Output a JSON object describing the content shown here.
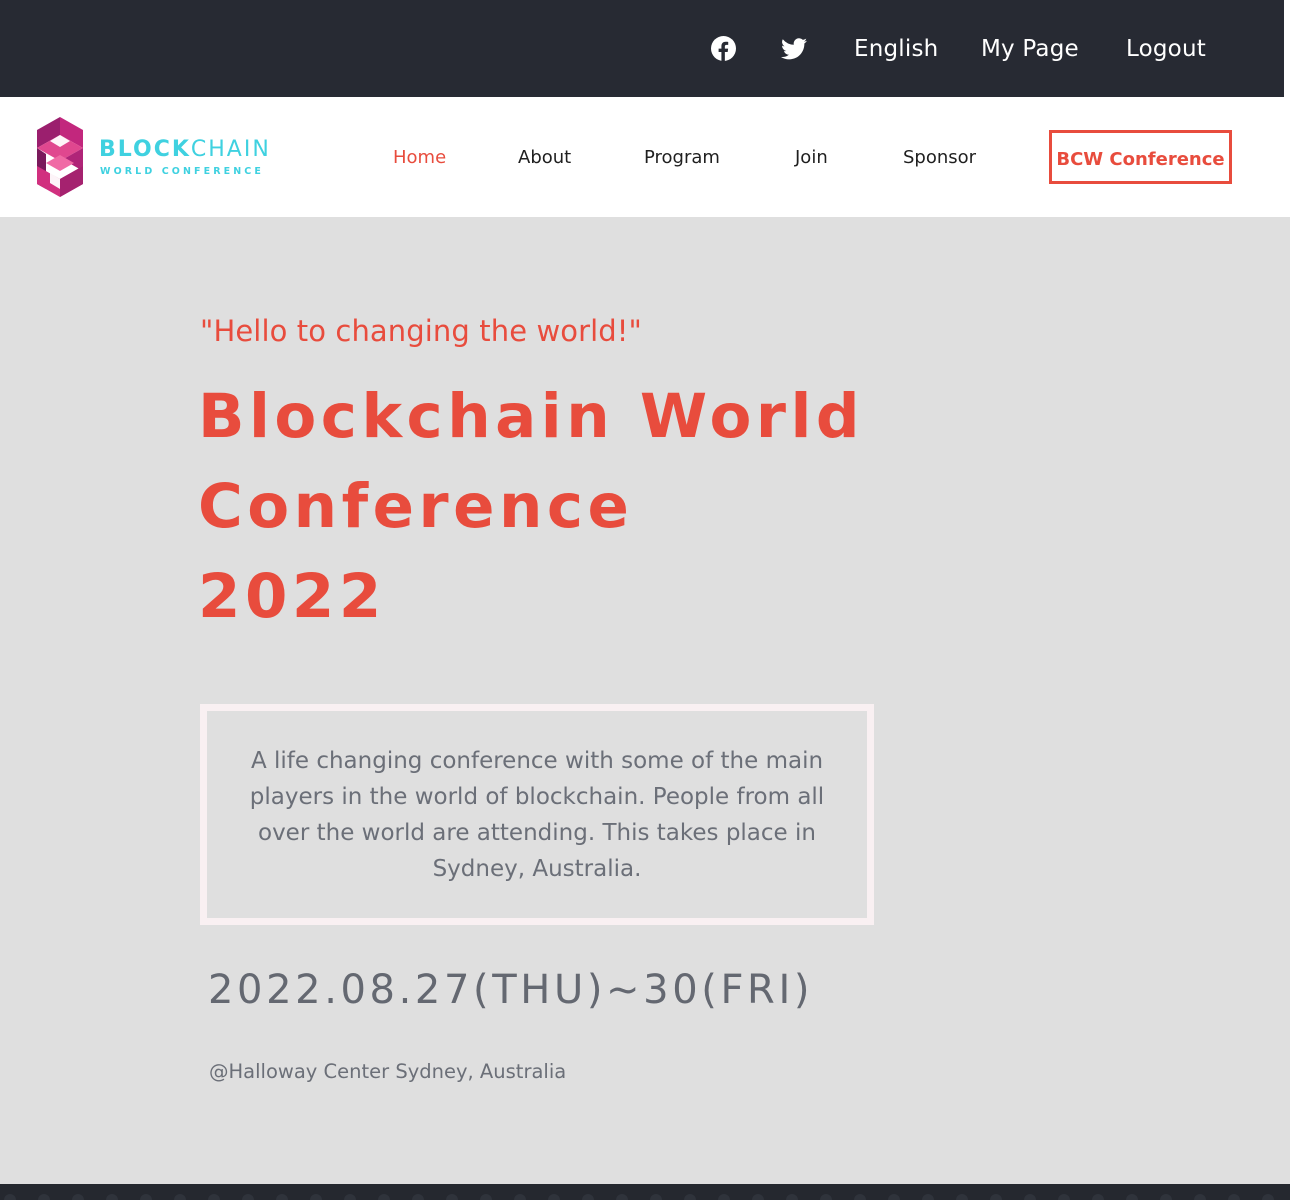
{
  "topbar": {
    "facebook_icon": "facebook-icon",
    "twitter_icon": "twitter-icon",
    "language": "English",
    "my_page": "My Page",
    "logout": "Logout"
  },
  "logo": {
    "word_bold": "BLOCK",
    "word_light": "CHAIN",
    "subtitle": "WORLD CONFERENCE"
  },
  "nav": {
    "items": [
      {
        "label": "Home",
        "active": true
      },
      {
        "label": "About",
        "active": false
      },
      {
        "label": "Program",
        "active": false
      },
      {
        "label": "Join",
        "active": false
      },
      {
        "label": "Sponsor",
        "active": false
      }
    ],
    "cta": "BCW Conference"
  },
  "hero": {
    "tagline": "\"Hello to changing the world!\"",
    "title_lines": [
      "Blockchain World",
      "Conference",
      "2022"
    ],
    "description": "A life changing conference with some of the main players in the world of blockchain. People from all over the world are attending. This takes place in Sydney, Australia.",
    "dates": "2022.08.27(THU)~30(FRI)",
    "venue": "@Halloway Center Sydney, Australia"
  },
  "colors": {
    "accent": "#e84c3d",
    "topbar_bg": "#272a33",
    "hero_bg": "#dfdfdf",
    "logo_cyan": "#3fd1e0",
    "logo_magenta": "#c2277d",
    "muted_text": "#6b6f78"
  }
}
